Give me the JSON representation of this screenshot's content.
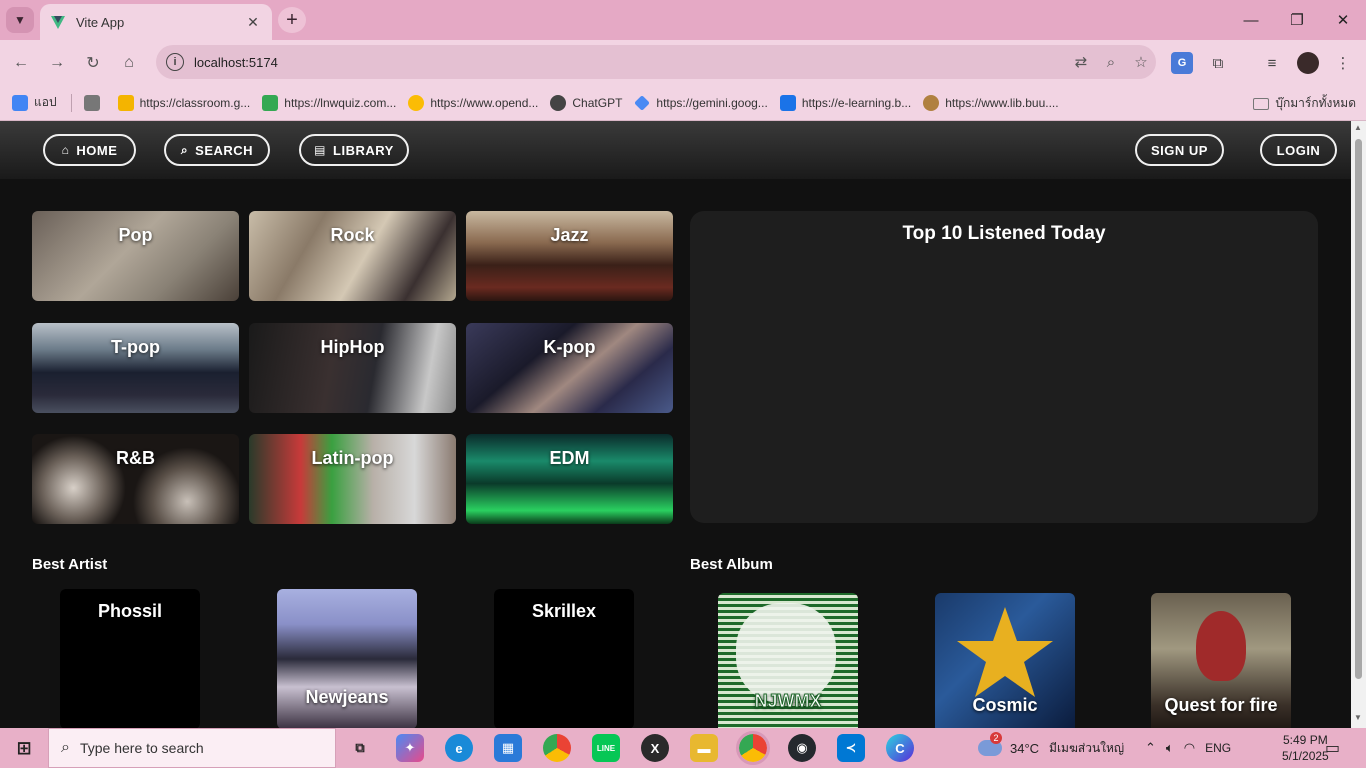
{
  "browser": {
    "tab_title": "Vite App",
    "url": "localhost:5174",
    "bookmarks": [
      {
        "label": "แอป",
        "color": "#4285f4"
      },
      {
        "label": "https://classroom.g...",
        "color": "#f4b400"
      },
      {
        "label": "https://lnwquiz.com...",
        "color": "#34a853"
      },
      {
        "label": "https://www.opend...",
        "color": "#fbbc05"
      },
      {
        "label": "ChatGPT",
        "color": "#444444"
      },
      {
        "label": "https://gemini.goog...",
        "color": "#4a8af4"
      },
      {
        "label": "https://e-learning.b...",
        "color": "#1a73e8"
      },
      {
        "label": "https://www.lib.buu....",
        "color": "#b08040"
      }
    ],
    "all_bookmarks": "บุ๊กมาร์กทั้งหมด"
  },
  "nav": {
    "home": "HOME",
    "search": "SEARCH",
    "library": "LIBRARY",
    "signup": "SIGN UP",
    "login": "LOGIN"
  },
  "genres": [
    {
      "label": "Pop"
    },
    {
      "label": "Rock"
    },
    {
      "label": "Jazz"
    },
    {
      "label": "T-pop"
    },
    {
      "label": "HipHop"
    },
    {
      "label": "K-pop"
    },
    {
      "label": "R&B"
    },
    {
      "label": "Latin-pop"
    },
    {
      "label": "EDM"
    }
  ],
  "top10": {
    "title": "Top 10 Listened Today"
  },
  "best_artist": {
    "title": "Best Artist",
    "items": [
      {
        "label": "Phossil"
      },
      {
        "label": "Newjeans"
      },
      {
        "label": "Skrillex"
      }
    ]
  },
  "best_album": {
    "title": "Best Album",
    "items": [
      {
        "label": "NJWMX"
      },
      {
        "label": "Cosmic"
      },
      {
        "label": "Quest for fire"
      }
    ]
  },
  "taskbar": {
    "search_placeholder": "Type here to search",
    "weather": "34°C",
    "weather_desc": "มีเมฆส่วนใหญ่",
    "weather_badge": "2",
    "lang": "ENG",
    "time": "5:49 PM",
    "date": "5/1/2025"
  }
}
